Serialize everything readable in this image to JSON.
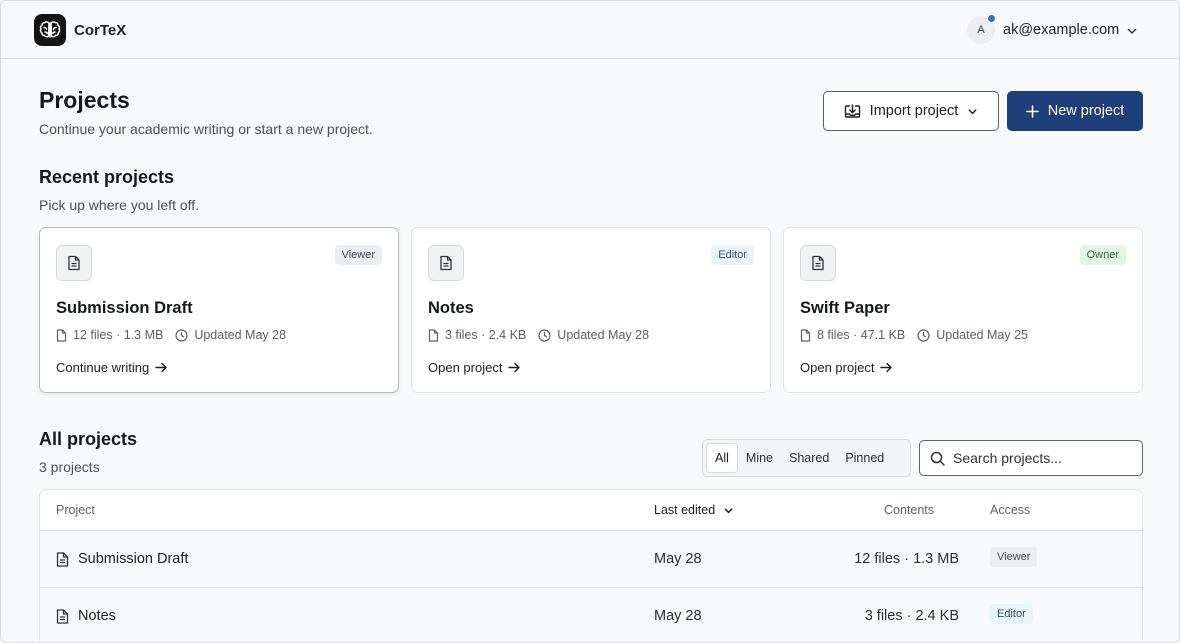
{
  "app": {
    "name": "CorTeX"
  },
  "user": {
    "avatar_initial": "A",
    "email": "ak@example.com"
  },
  "header": {
    "title": "Projects",
    "subtitle": "Continue your academic writing or start a new project.",
    "import_label": "Import project",
    "new_label": "New project"
  },
  "recent": {
    "title": "Recent projects",
    "subtitle": "Pick up where you left off.",
    "cards": [
      {
        "title": "Submission Draft",
        "files": "12 files · 1.3 MB",
        "updated": "Updated May 28",
        "role": "Viewer",
        "action": "Continue writing"
      },
      {
        "title": "Notes",
        "files": "3 files · 2.4 KB",
        "updated": "Updated May 28",
        "role": "Editor",
        "action": "Open project"
      },
      {
        "title": "Swift Paper",
        "files": "8 files · 47.1 KB",
        "updated": "Updated May 25",
        "role": "Owner",
        "action": "Open project"
      }
    ]
  },
  "all": {
    "title": "All projects",
    "count": "3 projects",
    "filters": [
      "All",
      "Mine",
      "Shared",
      "Pinned"
    ],
    "search_placeholder": "Search projects...",
    "columns": {
      "project": "Project",
      "last_edited": "Last edited",
      "contents": "Contents",
      "access": "Access"
    },
    "rows": [
      {
        "name": "Submission Draft",
        "date": "May 28",
        "contents": "12 files · 1.3 MB",
        "access": "Viewer"
      },
      {
        "name": "Notes",
        "date": "May 28",
        "contents": "3 files · 2.4 KB",
        "access": "Editor"
      }
    ]
  }
}
